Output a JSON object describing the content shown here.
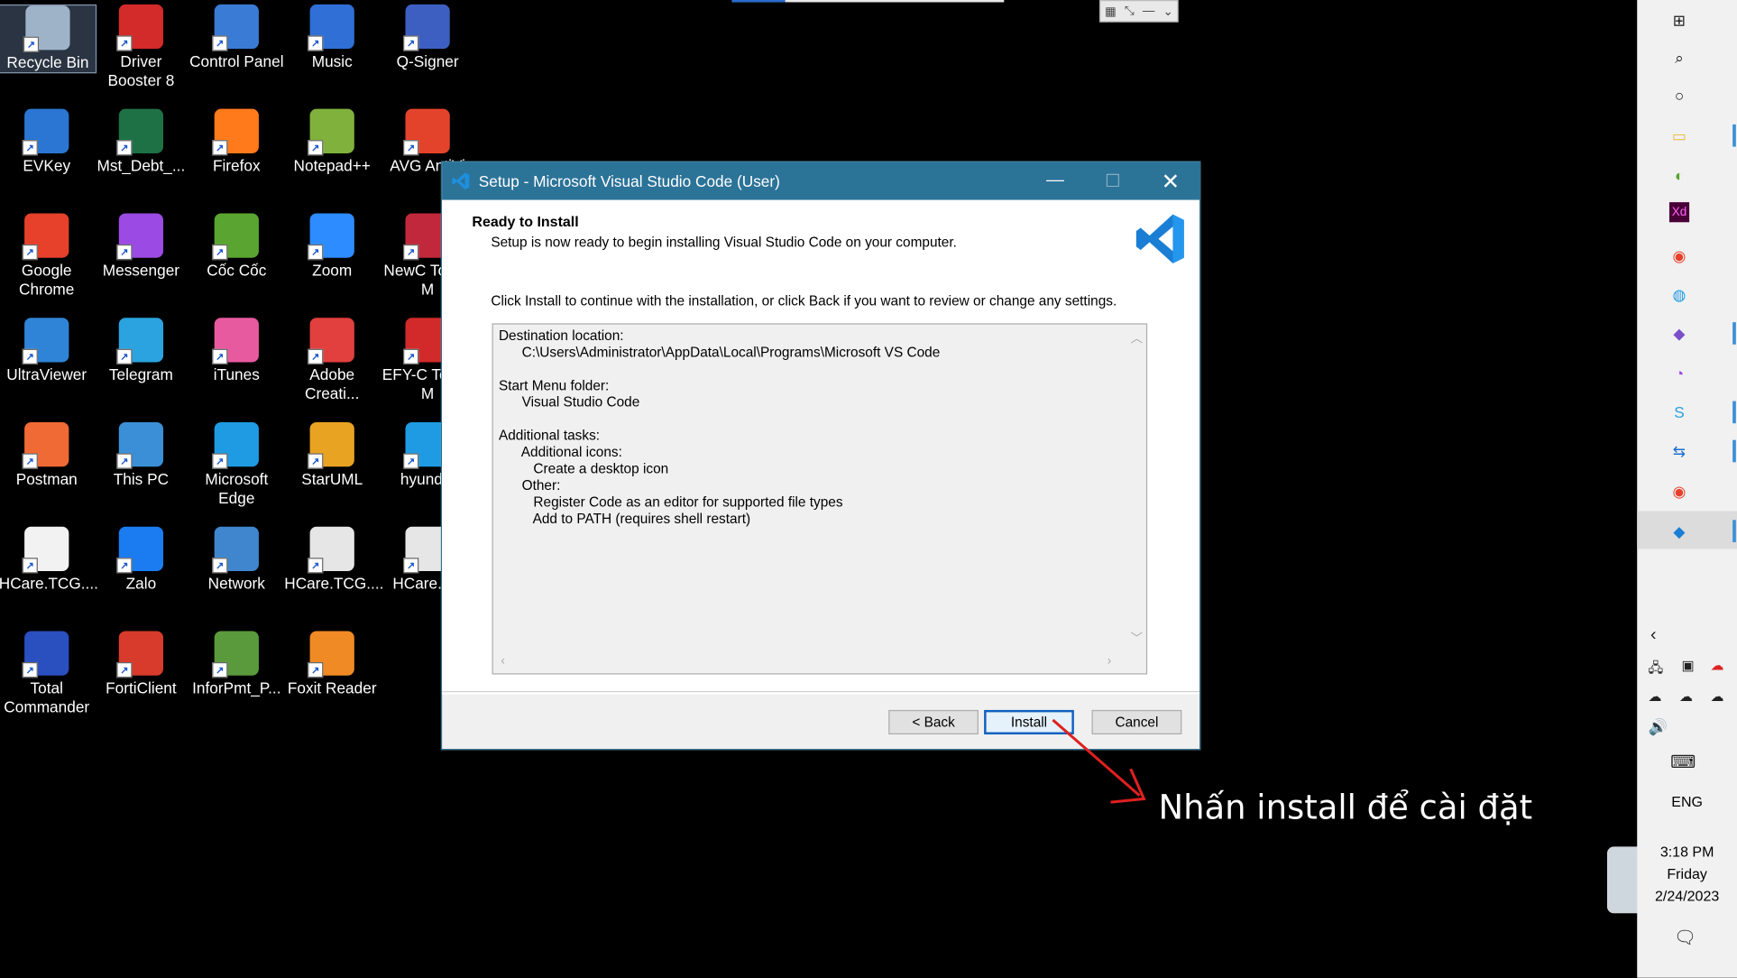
{
  "desktop": {
    "icons": [
      {
        "label": "Recycle Bin",
        "icon": "recycle-bin-icon",
        "color": "#9fb3c8"
      },
      {
        "label": "Driver Booster 8",
        "icon": "driver-booster-icon",
        "color": "#d32a2a"
      },
      {
        "label": "Control Panel",
        "icon": "control-panel-icon",
        "color": "#3a7bd5"
      },
      {
        "label": "Music",
        "icon": "music-folder-icon",
        "color": "#2f6fd6"
      },
      {
        "label": "Q-Signer",
        "icon": "q-signer-icon",
        "color": "#3c5fc1"
      },
      {
        "label": "EVKey",
        "icon": "evkey-icon",
        "color": "#2a76d2"
      },
      {
        "label": "Mst_Debt_...",
        "icon": "excel-file-icon",
        "color": "#1e7145"
      },
      {
        "label": "Firefox",
        "icon": "firefox-icon",
        "color": "#ff7a1a"
      },
      {
        "label": "Notepad++",
        "icon": "notepad-plus-icon",
        "color": "#7fb13c"
      },
      {
        "label": "AVG AntiVi",
        "icon": "avg-antivirus-icon",
        "color": "#e4432b"
      },
      {
        "label": "Google Chrome",
        "icon": "chrome-icon",
        "color": "#e7402b"
      },
      {
        "label": "Messenger",
        "icon": "messenger-icon",
        "color": "#9b4ae3"
      },
      {
        "label": "Cốc Cốc",
        "icon": "coc-coc-icon",
        "color": "#5aa531"
      },
      {
        "label": "Zoom",
        "icon": "zoom-icon",
        "color": "#2d8cff"
      },
      {
        "label": "NewC Token M",
        "icon": "newca-token-icon",
        "color": "#c2283b"
      },
      {
        "label": "UltraViewer",
        "icon": "ultraviewer-icon",
        "color": "#2f84d8"
      },
      {
        "label": "Telegram",
        "icon": "telegram-icon",
        "color": "#2aa3e0"
      },
      {
        "label": "iTunes",
        "icon": "itunes-icon",
        "color": "#e85aa0"
      },
      {
        "label": "Adobe Creati...",
        "icon": "adobe-creative-cloud-icon",
        "color": "#e23f3f"
      },
      {
        "label": "EFY-C Token M",
        "icon": "efy-token-icon",
        "color": "#d22a2a"
      },
      {
        "label": "Postman",
        "icon": "postman-icon",
        "color": "#f06a35"
      },
      {
        "label": "This PC",
        "icon": "this-pc-icon",
        "color": "#3b8fd6"
      },
      {
        "label": "Microsoft Edge",
        "icon": "edge-icon",
        "color": "#1f9be3"
      },
      {
        "label": "StarUML",
        "icon": "staruml-icon",
        "color": "#e8a323"
      },
      {
        "label": "hyundai",
        "icon": "edge-icon",
        "color": "#1f9be3"
      },
      {
        "label": "HCare.TCG....",
        "icon": "file-icon",
        "color": "#f2f2f2"
      },
      {
        "label": "Zalo",
        "icon": "zalo-icon",
        "color": "#1a7cf0"
      },
      {
        "label": "Network",
        "icon": "network-icon",
        "color": "#3f86cf"
      },
      {
        "label": "HCare.TCG....",
        "icon": "config-file-icon",
        "color": "#e6e6e6"
      },
      {
        "label": "HCare.TC",
        "icon": "text-file-icon",
        "color": "#e6e6e6"
      },
      {
        "label": "Total Commander",
        "icon": "total-commander-icon",
        "color": "#2a4fbf"
      },
      {
        "label": "FortiClient",
        "icon": "forticlient-icon",
        "color": "#d83b2b"
      },
      {
        "label": "InforPmt_P...",
        "icon": "infor-pmt-icon",
        "color": "#5a9a3c"
      },
      {
        "label": "Foxit Reader",
        "icon": "foxit-reader-icon",
        "color": "#f08a24"
      }
    ]
  },
  "installer": {
    "title": "Setup - Microsoft Visual Studio Code (User)",
    "heading": "Ready to Install",
    "subheading": "Setup is now ready to begin installing Visual Studio Code on your computer.",
    "instruction": "Click Install to continue with the installation, or click Back if you want to review or change any settings.",
    "summary": "Destination location:\n      C:\\Users\\Administrator\\AppData\\Local\\Programs\\Microsoft VS Code\n\nStart Menu folder:\n      Visual Studio Code\n\nAdditional tasks:\n      Additional icons:\n         Create a desktop icon\n      Other:\n         Register Code as an editor for supported file types\n         Add to PATH (requires shell restart)",
    "buttons": {
      "back": "< Back",
      "install": "Install",
      "cancel": "Cancel"
    },
    "accent": "#2c7398"
  },
  "annotation": {
    "text": "Nhấn install để cài đặt",
    "arrow_color": "#e02020"
  },
  "taskbar": {
    "icons": [
      "windows-start-icon",
      "search-icon",
      "cortana-icon",
      "file-explorer-icon",
      "coc-coc-icon",
      "adobe-xd-icon",
      "chrome-icon",
      "edge-icon",
      "visual-studio-icon",
      "messenger-icon",
      "skype-icon",
      "teamviewer-icon",
      "chrome-icon",
      "vscode-icon"
    ],
    "language": "ENG",
    "time": "3:18 PM",
    "day": "Friday",
    "date": "2/24/2023"
  }
}
